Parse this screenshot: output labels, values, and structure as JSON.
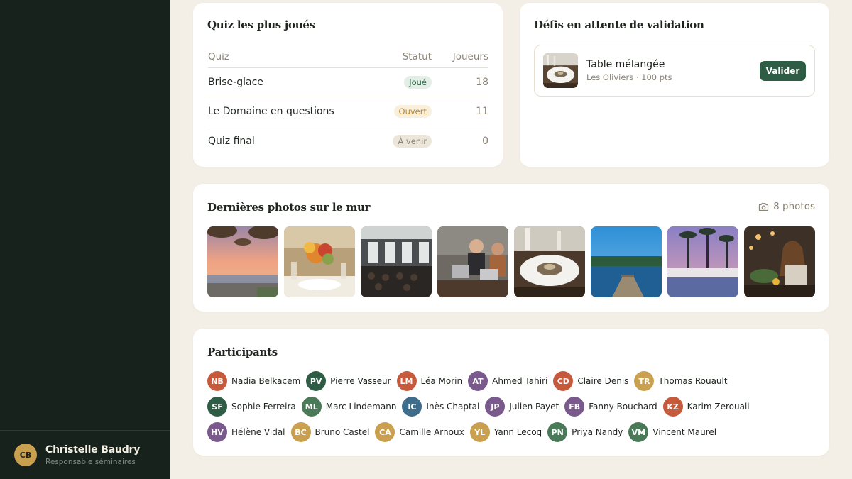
{
  "user": {
    "initials": "CB",
    "name": "Christelle Baudry",
    "role": "Responsable séminaires",
    "avatar_color": "#c9a04f"
  },
  "quiz_card": {
    "title": "Quiz les plus joués",
    "headers": {
      "quiz": "Quiz",
      "status": "Statut",
      "players": "Joueurs"
    },
    "rows": [
      {
        "name": "Brise-glace",
        "status": "Joué",
        "status_kind": "played",
        "players": "18"
      },
      {
        "name": "Le Domaine en questions",
        "status": "Ouvert",
        "status_kind": "open",
        "players": "11"
      },
      {
        "name": "Quiz final",
        "status": "À venir",
        "status_kind": "soon",
        "players": "0"
      }
    ]
  },
  "challenges_card": {
    "title": "Défis en attente de validation",
    "items": [
      {
        "name": "Table mélangée",
        "meta": "Les Oliviers · 100 pts",
        "action": "Valider",
        "thumb_icon": "plated-dish-photo"
      }
    ]
  },
  "photos_card": {
    "title": "Dernières photos sur le mur",
    "count_label": "8 photos",
    "photos": [
      {
        "icon": "beach-sunset-photo"
      },
      {
        "icon": "table-flowers-photo"
      },
      {
        "icon": "conference-hall-photo"
      },
      {
        "icon": "coworking-laptops-photo"
      },
      {
        "icon": "plated-dish-photo"
      },
      {
        "icon": "lake-pier-photo"
      },
      {
        "icon": "palm-pool-photo"
      },
      {
        "icon": "woman-dining-photo"
      }
    ]
  },
  "participants_card": {
    "title": "Participants",
    "people": [
      {
        "initials": "NB",
        "name": "Nadia Belkacem",
        "color": "#c65a3c"
      },
      {
        "initials": "PV",
        "name": "Pierre Vasseur",
        "color": "#2e5c45"
      },
      {
        "initials": "LM",
        "name": "Léa Morin",
        "color": "#c65a3c"
      },
      {
        "initials": "AT",
        "name": "Ahmed Tahiri",
        "color": "#7a5a8c"
      },
      {
        "initials": "CD",
        "name": "Claire Denis",
        "color": "#c65a3c"
      },
      {
        "initials": "TR",
        "name": "Thomas Rouault",
        "color": "#c9a04f"
      },
      {
        "initials": "SF",
        "name": "Sophie Ferreira",
        "color": "#2e5c45"
      },
      {
        "initials": "ML",
        "name": "Marc Lindemann",
        "color": "#4a7a57"
      },
      {
        "initials": "IC",
        "name": "Inès Chaptal",
        "color": "#3d6d8a"
      },
      {
        "initials": "JP",
        "name": "Julien Payet",
        "color": "#7a5a8c"
      },
      {
        "initials": "FB",
        "name": "Fanny Bouchard",
        "color": "#7a5a8c"
      },
      {
        "initials": "KZ",
        "name": "Karim Zerouali",
        "color": "#c65a3c"
      },
      {
        "initials": "HV",
        "name": "Hélène Vidal",
        "color": "#7a5a8c"
      },
      {
        "initials": "BC",
        "name": "Bruno Castel",
        "color": "#c9a04f"
      },
      {
        "initials": "CA",
        "name": "Camille Arnoux",
        "color": "#c9a04f"
      },
      {
        "initials": "YL",
        "name": "Yann Lecoq",
        "color": "#c9a04f"
      },
      {
        "initials": "PN",
        "name": "Priya Nandy",
        "color": "#4a7a57"
      },
      {
        "initials": "VM",
        "name": "Vincent Maurel",
        "color": "#4a7a57"
      }
    ]
  }
}
